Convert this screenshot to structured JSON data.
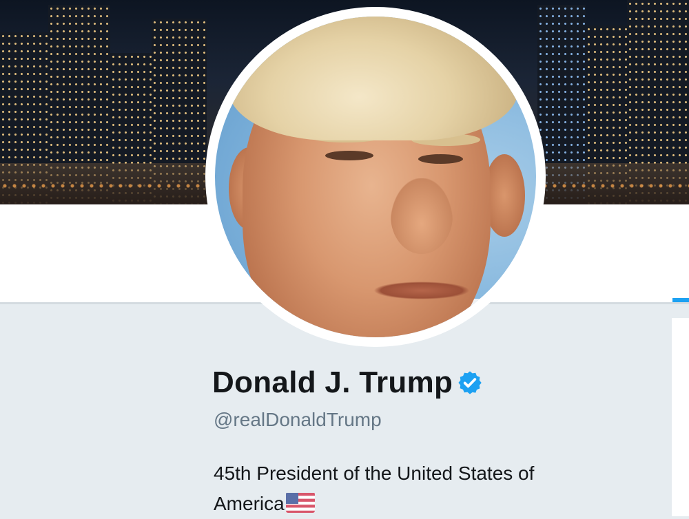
{
  "profile": {
    "display_name": "Donald J. Trump",
    "verified": true,
    "handle": "@realDonaldTrump",
    "bio": {
      "line1": "45th President of the United States of",
      "line2": "America"
    },
    "bio_emoji": "flag-us-icon"
  },
  "icons": {
    "verified": "verified-badge-icon",
    "flag": "flag-us-icon"
  },
  "colors": {
    "accent": "#1da1f2",
    "name_text": "#14171a",
    "handle_text": "#657786",
    "page_background": "#e6ecf0"
  }
}
